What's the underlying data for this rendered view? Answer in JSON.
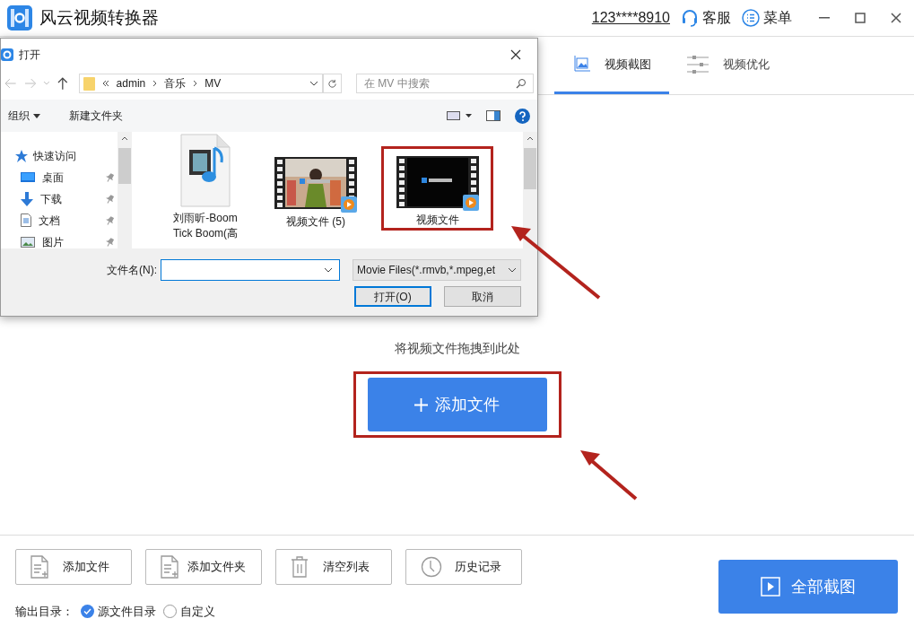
{
  "app": {
    "title": "风云视频转换器",
    "account": "123****8910",
    "support": "客服",
    "menu": "菜单"
  },
  "tabs": [
    {
      "label": "视频截图",
      "selected": true
    },
    {
      "label": "视频优化",
      "selected": false
    }
  ],
  "dropzone": {
    "hint": "将视频文件拖拽到此处",
    "add_button": "添加文件"
  },
  "tools": [
    {
      "label": "添加文件",
      "kind": "file"
    },
    {
      "label": "添加文件夹",
      "kind": "folder"
    },
    {
      "label": "清空列表",
      "kind": "trash"
    },
    {
      "label": "历史记录",
      "kind": "history"
    }
  ],
  "output": {
    "label": "输出目录：",
    "options": [
      {
        "label": "源文件目录",
        "selected": true
      },
      {
        "label": "自定义",
        "selected": false
      }
    ]
  },
  "action_button": "全部截图",
  "dialog": {
    "title": "打开",
    "path": [
      "admin",
      "音乐",
      "MV"
    ],
    "search_placeholder": "在 MV 中搜索",
    "toolbar": [
      "组织",
      "新建文件夹"
    ],
    "nav": [
      {
        "label": "快速访问",
        "kind": "quick"
      },
      {
        "label": "桌面",
        "kind": "desktop"
      },
      {
        "label": "下载",
        "kind": "download"
      },
      {
        "label": "文档",
        "kind": "document"
      },
      {
        "label": "图片",
        "kind": "picture"
      }
    ],
    "files": [
      {
        "name": "刘雨昕-Boom Tick Boom(高",
        "kind": "audio"
      },
      {
        "name": "视频文件 (5)",
        "kind": "video"
      },
      {
        "name": "视频文件",
        "kind": "video"
      }
    ],
    "filename_label": "文件名(N):",
    "filetype": "Movie Files(*.rmvb,*.mpeg,et",
    "open_button": "打开(O)",
    "cancel_button": "取消"
  }
}
